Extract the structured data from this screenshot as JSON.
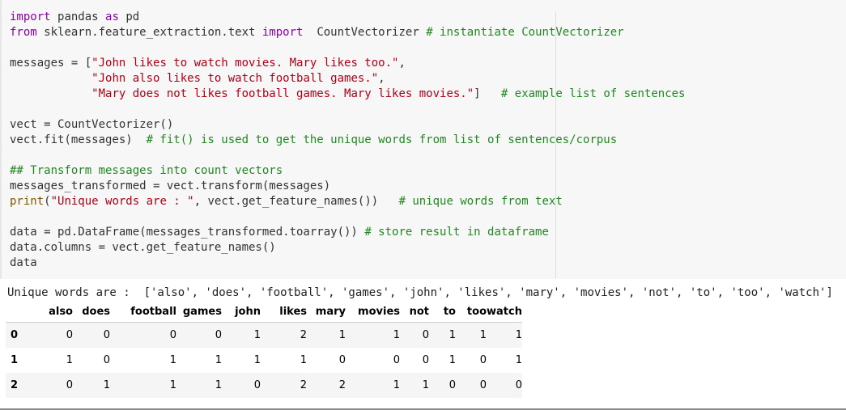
{
  "code_lines": [
    [
      [
        "kw",
        "import"
      ],
      [
        "",
        "pandas"
      ],
      [
        "kw",
        "as"
      ],
      [
        "",
        "pd"
      ]
    ],
    [
      [
        "kw",
        "from"
      ],
      [
        "",
        "sklearn.feature_extraction.text"
      ],
      [
        "kw",
        "import"
      ],
      [
        "",
        "CountVectorizer"
      ],
      [
        "cm",
        "# instantiate CountVectorizer"
      ]
    ],
    [],
    [
      [
        "",
        "messages = ["
      ],
      [
        "str",
        "\"John likes to watch movies. Mary likes too.\""
      ],
      [
        "",
        ","
      ]
    ],
    [
      [
        "str",
        "\"John also likes to watch football games.\""
      ],
      [
        "",
        ","
      ]
    ],
    [
      [
        "str",
        "\"Mary does not likes football games. Mary likes movies.\""
      ],
      [
        "",
        "]"
      ],
      [
        "cm",
        "# example list of sentences"
      ]
    ],
    [],
    [
      [
        "",
        "vect = CountVectorizer()"
      ]
    ],
    [
      [
        "",
        "vect.fit(messages)"
      ],
      [
        "cm",
        "# fit() is used to get the unique words from list of sentences/corpus"
      ]
    ],
    [],
    [
      [
        "cm",
        "## Transform messages into count vectors"
      ]
    ],
    [
      [
        "",
        "messages_transformed = vect.transform(messages)"
      ]
    ],
    [
      [
        "bi",
        "print"
      ],
      [
        "",
        "("
      ],
      [
        "str",
        "\"Unique words are : \""
      ],
      [
        "",
        ", vect.get_feature_names())"
      ],
      [
        "cm",
        "# unique words from text"
      ]
    ],
    [],
    [
      [
        "",
        "data = pd.DataFrame(messages_transformed.toarray())"
      ],
      [
        "cm",
        "# store result in dataframe"
      ]
    ],
    [
      [
        "",
        "data.columns = vect.get_feature_names()"
      ]
    ],
    [
      [
        "",
        "data"
      ]
    ]
  ],
  "output_text": "Unique words are :  ['also', 'does', 'football', 'games', 'john', 'likes', 'mary', 'movies', 'not', 'to', 'too', 'watch']",
  "table": {
    "columns": [
      "also",
      "does",
      "football",
      "games",
      "john",
      "likes",
      "mary",
      "movies",
      "not",
      "to",
      "too",
      "watch"
    ],
    "index": [
      "0",
      "1",
      "2"
    ],
    "rows": [
      [
        "0",
        "0",
        "0",
        "0",
        "1",
        "2",
        "1",
        "1",
        "0",
        "1",
        "1",
        "1"
      ],
      [
        "1",
        "0",
        "1",
        "1",
        "1",
        "1",
        "0",
        "0",
        "0",
        "1",
        "0",
        "1"
      ],
      [
        "0",
        "1",
        "1",
        "1",
        "0",
        "2",
        "2",
        "1",
        "1",
        "0",
        "0",
        "0"
      ]
    ]
  }
}
